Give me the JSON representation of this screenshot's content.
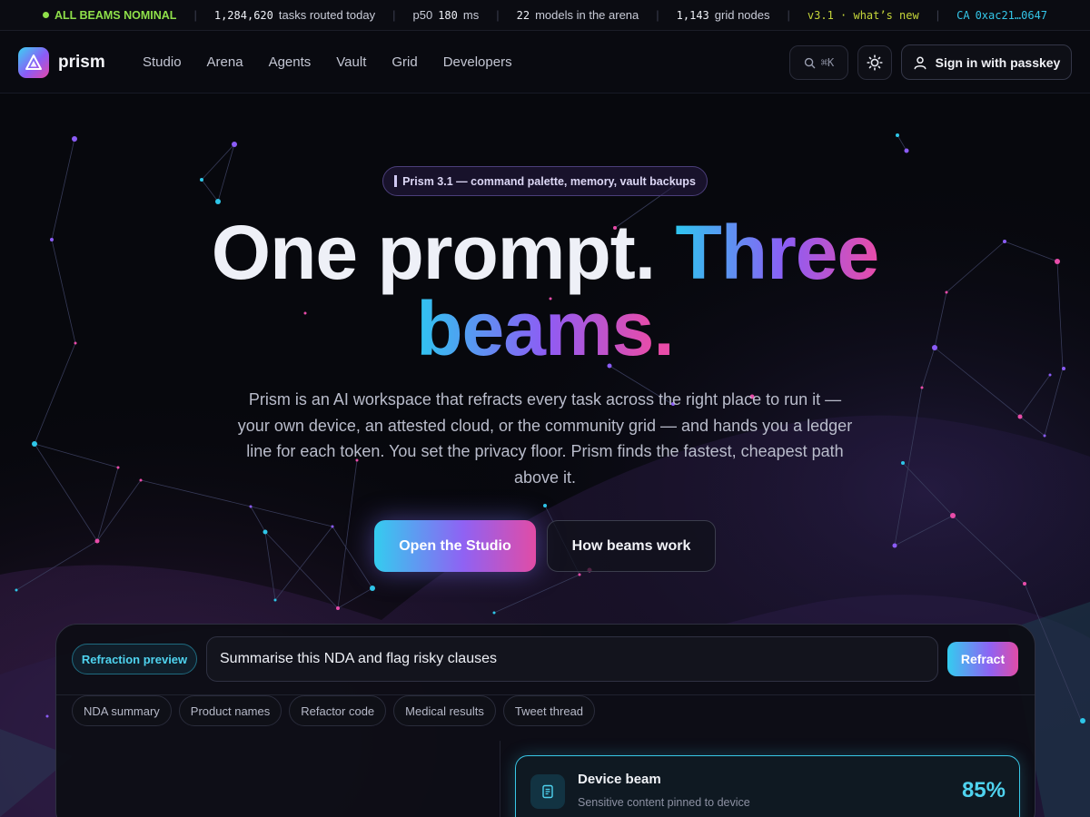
{
  "ticker": {
    "status": "ALL BEAMS NOMINAL",
    "tasks_value": "1,284,620",
    "tasks_label": "tasks routed today",
    "latency_label": "p50",
    "latency_value": "180",
    "latency_unit": "ms",
    "models_value": "22",
    "models_label": "models in the arena",
    "nodes_value": "1,143",
    "nodes_label": "grid nodes",
    "version": "v3.1 · what’s new",
    "ca_label": "CA",
    "ca_value": "0xac21…0647",
    "status_color": "#8fe04a"
  },
  "nav": {
    "brand": "prism",
    "links": [
      "Studio",
      "Arena",
      "Agents",
      "Vault",
      "Grid",
      "Developers"
    ],
    "search_shortcut": "⌘K",
    "signin_label": "Sign in with passkey"
  },
  "hero": {
    "pill_text": "Prism 3.1 — command palette, memory, vault backups",
    "headline_plain": "One prompt. ",
    "headline_grad_1": "Three",
    "headline_grad_2": "beams",
    "headline_dot": ".",
    "lede": "Prism is an AI workspace that refracts every task across the right place to run it — your own device, an attested cloud, or the community grid — and hands you a ledger line for each token. You set the privacy floor. Prism finds the fastest, cheapest path above it.",
    "cta_primary": "Open the Studio",
    "cta_secondary": "How beams work"
  },
  "preview": {
    "label": "Refraction preview",
    "prompt_value": "Summarise this NDA and flag risky clauses",
    "refract_label": "Refract",
    "chips": [
      "NDA summary",
      "Product names",
      "Refactor code",
      "Medical results",
      "Tweet thread"
    ],
    "beam": {
      "title": "Device beam",
      "subtitle": "Sensitive content pinned to device",
      "percent": "85%"
    }
  },
  "colors": {
    "accent_cyan": "#34ccef",
    "accent_violet": "#8f62f3",
    "accent_pink": "#e14ca6"
  }
}
